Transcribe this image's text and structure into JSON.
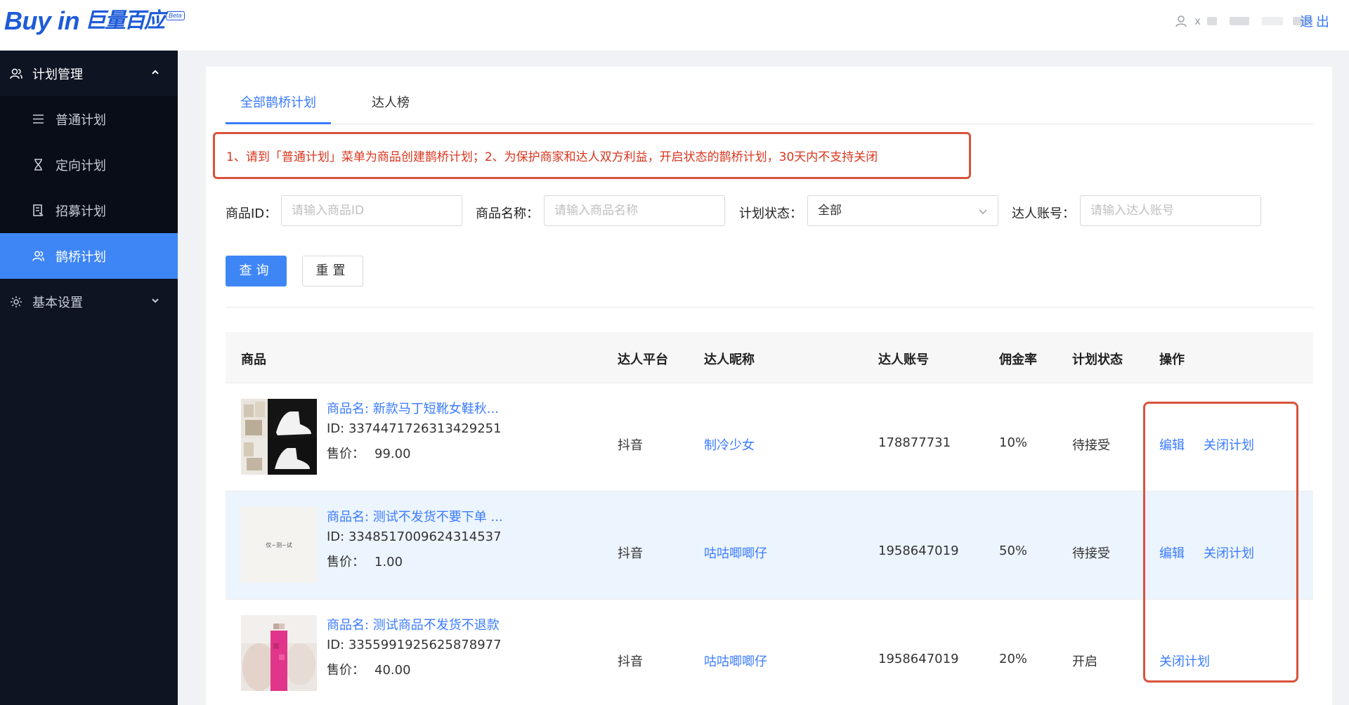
{
  "header": {
    "logo_text": "Buy in",
    "logo_cn": "巨量百应",
    "logo_badge": "Beta",
    "user_name": "x",
    "logout_label": "退出"
  },
  "sidebar": {
    "group_plan": "计划管理",
    "items": [
      {
        "label": "普通计划",
        "icon": "list-icon"
      },
      {
        "label": "定向计划",
        "icon": "hourglass-icon"
      },
      {
        "label": "招募计划",
        "icon": "recruit-icon"
      },
      {
        "label": "鹊桥计划",
        "icon": "users-icon",
        "active": true
      }
    ],
    "group_settings": "基本设置"
  },
  "tabs": [
    {
      "label": "全部鹊桥计划",
      "active": true
    },
    {
      "label": "达人榜",
      "active": false
    }
  ],
  "notice": "1、请到「普通计划」菜单为商品创建鹊桥计划；2、为保护商家和达人双方利益，开启状态的鹊桥计划，30天内不支持关闭",
  "filters": {
    "product_id_label": "商品ID：",
    "product_id_placeholder": "请输入商品ID",
    "product_name_label": "商品名称：",
    "product_name_placeholder": "请输入商品名称",
    "status_label": "计划状态：",
    "status_value": "全部",
    "account_label": "达人账号：",
    "account_placeholder": "请输入达人账号"
  },
  "buttons": {
    "query": "查询",
    "reset": "重置"
  },
  "table": {
    "headers": [
      "商品",
      "达人平台",
      "达人昵称",
      "达人账号",
      "佣金率",
      "计划状态",
      "操作"
    ],
    "rows": [
      {
        "name": "商品名: 新款马丁短靴女鞋秋...",
        "id": "ID: 3374471726313429251",
        "price_label": "售价：",
        "price": "99.00",
        "platform": "抖音",
        "nickname": "制冷少女",
        "account": "178877731",
        "rate": "10%",
        "status": "待接受",
        "op1": "编辑",
        "op2": "关闭计划"
      },
      {
        "name": "商品名: 测试不发货不要下单 ...",
        "id": "ID: 3348517009624314537",
        "price_label": "售价：",
        "price": "1.00",
        "platform": "抖音",
        "nickname": "咕咕唧唧仔",
        "account": "1958647019",
        "rate": "50%",
        "status": "待接受",
        "op1": "编辑",
        "op2": "关闭计划",
        "thumb_text": "仅~测~试"
      },
      {
        "name": "商品名: 测试商品不发货不退款",
        "id": "ID: 3355991925625878977",
        "price_label": "售价：",
        "price": "40.00",
        "platform": "抖音",
        "nickname": "咕咕唧唧仔",
        "account": "1958647019",
        "rate": "20%",
        "status": "开启",
        "op1": "关闭计划"
      }
    ]
  },
  "colors": {
    "brand": "#1e5bd8",
    "primary": "#3e86f5",
    "link": "#3a7bff",
    "sidebar_bg": "#0f1423",
    "highlight_border": "#d9533c",
    "notice_text": "#d9361f"
  }
}
